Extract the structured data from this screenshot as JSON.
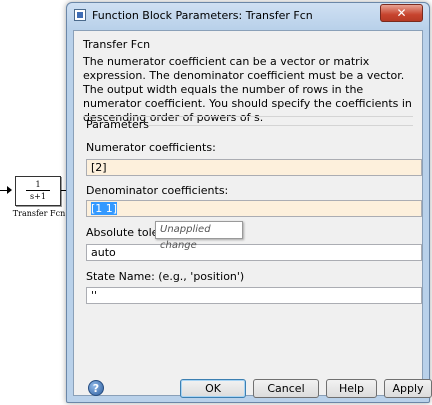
{
  "canvas": {
    "block": {
      "numerator": "1",
      "denominator": "s+1",
      "name": "Transfer Fcn"
    }
  },
  "dialog": {
    "title": "Function Block Parameters: Transfer Fcn",
    "close_icon": "close-icon",
    "section_title": "Transfer Fcn",
    "description": "The numerator coefficient can be a vector or matrix expression. The denominator coefficient must be a vector. The output width equals the number of rows in the numerator coefficient. You should specify the coefficients in descending order of powers of s.",
    "parameters_title": "Parameters",
    "numerator_label": "Numerator coefficients:",
    "numerator_value": "[2]",
    "denominator_label": "Denominator coefficients:",
    "denominator_value": "[1 1]",
    "tooltip": "Unapplied change",
    "tolerance_label": "Absolute tolera",
    "tolerance_value": "auto",
    "state_label": "State Name: (e.g., 'position')",
    "state_value": "''",
    "buttons": {
      "ok": "OK",
      "cancel": "Cancel",
      "help": "Help",
      "apply": "Apply"
    },
    "help_icon": "help-icon"
  },
  "colors": {
    "modified_field": "#fdf0dc",
    "selection": "#3399ff",
    "close_button": "#c7442e"
  }
}
